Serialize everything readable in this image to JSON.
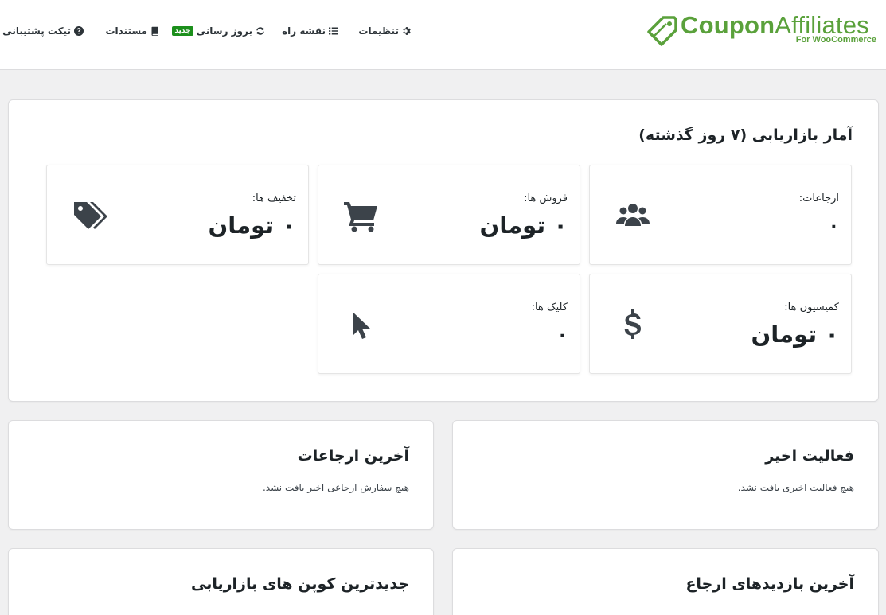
{
  "brand": {
    "name_bold": "Coupon",
    "name_light": "Affiliates",
    "tagline": "For WooCommerce"
  },
  "nav": {
    "settings": "تنظیمات",
    "roadmap": "نقشه راه",
    "updates": "بروز رسانی",
    "updates_badge": "جدید",
    "docs": "مستندات",
    "support": "تیکت پشتیبانی"
  },
  "stats": {
    "title": "آمار بازاریابی (۷ روز گذشته)",
    "referrals": {
      "label": "ارجاعات:",
      "value": "۰"
    },
    "sales": {
      "label": "فروش ها:",
      "value": "۰ تومان"
    },
    "discounts": {
      "label": "تخفیف ها:",
      "value": "۰ تومان"
    },
    "commission": {
      "label": "کمیسیون ها:",
      "value": "۰ تومان"
    },
    "clicks": {
      "label": "کلیک ها:",
      "value": "۰"
    }
  },
  "recent_activity": {
    "title": "فعالیت اخیر",
    "empty": "هیچ فعالیت اخیری یافت نشد."
  },
  "latest_referrals": {
    "title": "آخرین ارجاعات",
    "empty": "هیچ سفارش ارجاعی اخیر یافت نشد."
  },
  "latest_visits": {
    "title": "آخرین بازدیدهای ارجاع"
  },
  "newest_coupons": {
    "title": "جدیدترین کوپن های بازاریابی"
  },
  "colors": {
    "brand_green": "#5aa13b",
    "badge_green": "#1b8f1b",
    "page_bg": "#f0f0f1"
  }
}
